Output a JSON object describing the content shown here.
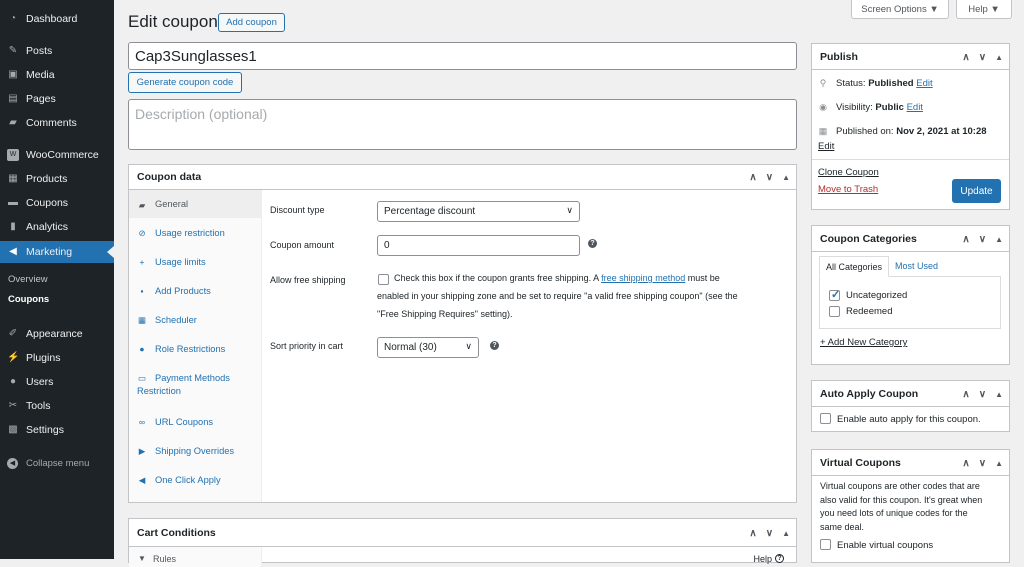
{
  "sidebar": {
    "items": [
      {
        "label": "Dashboard",
        "icon": "dashboard-icon"
      },
      {
        "label": "Posts",
        "icon": "pin-icon"
      },
      {
        "label": "Media",
        "icon": "media-icon"
      },
      {
        "label": "Pages",
        "icon": "pages-icon"
      },
      {
        "label": "Comments",
        "icon": "comments-icon"
      },
      {
        "label": "WooCommerce",
        "icon": "woocommerce-icon"
      },
      {
        "label": "Products",
        "icon": "products-icon"
      },
      {
        "label": "Coupons",
        "icon": "coupons-icon"
      },
      {
        "label": "Analytics",
        "icon": "analytics-icon"
      },
      {
        "label": "Marketing",
        "icon": "megaphone-icon"
      },
      {
        "label": "Appearance",
        "icon": "brush-icon"
      },
      {
        "label": "Plugins",
        "icon": "plugins-icon"
      },
      {
        "label": "Users",
        "icon": "users-icon"
      },
      {
        "label": "Tools",
        "icon": "tools-icon"
      },
      {
        "label": "Settings",
        "icon": "settings-icon"
      }
    ],
    "submenu": [
      "Overview",
      "Coupons"
    ],
    "collapse": "Collapse menu"
  },
  "top": {
    "screen_options": "Screen Options ▼",
    "help": "Help ▼"
  },
  "header": {
    "title": "Edit coupon",
    "add_button": "Add coupon"
  },
  "coupon": {
    "code": "Cap3Sunglasses1",
    "generate_button": "Generate coupon code",
    "description_placeholder": "Description (optional)"
  },
  "coupon_data": {
    "title": "Coupon data",
    "tabs": [
      {
        "label": "General",
        "icon": "general-icon"
      },
      {
        "label": "Usage restriction",
        "icon": "restriction-icon"
      },
      {
        "label": "Usage limits",
        "icon": "limits-icon"
      },
      {
        "label": "Add Products",
        "icon": "add-products-icon"
      },
      {
        "label": "Scheduler",
        "icon": "calendar-icon"
      },
      {
        "label": "Role Restrictions",
        "icon": "role-icon"
      },
      {
        "label": "Payment Methods Restriction",
        "icon": "payment-icon"
      },
      {
        "label": "URL Coupons",
        "icon": "link-icon"
      },
      {
        "label": "Shipping Overrides",
        "icon": "shipping-icon"
      },
      {
        "label": "One Click Apply",
        "icon": "click-icon"
      }
    ],
    "fields": {
      "discount_type_label": "Discount type",
      "discount_type_value": "Percentage discount",
      "coupon_amount_label": "Coupon amount",
      "coupon_amount_value": "0",
      "free_shipping_label": "Allow free shipping",
      "free_shipping_text_1": "Check this box if the coupon grants free shipping. A",
      "free_shipping_link": "free shipping method",
      "free_shipping_text_2": "must be",
      "free_shipping_text_3": "enabled in your shipping zone and be set to require \"a valid free shipping coupon\" (see the",
      "free_shipping_text_4": "\"Free Shipping Requires\" setting).",
      "sort_priority_label": "Sort priority in cart",
      "sort_priority_value": "Normal (30)"
    }
  },
  "cart_conditions": {
    "title": "Cart Conditions",
    "rules_label": "Rules",
    "help": "Help"
  },
  "publish": {
    "title": "Publish",
    "status_label": "Status:",
    "status_value": "Published",
    "visibility_label": "Visibility:",
    "visibility_value": "Public",
    "published_label": "Published on:",
    "published_value": "Nov 2, 2021 at 10:28",
    "edit": "Edit",
    "clone": "Clone Coupon",
    "trash": "Move to Trash",
    "update": "Update"
  },
  "categories": {
    "title": "Coupon Categories",
    "tab_all": "All Categories",
    "tab_used": "Most Used",
    "items": [
      {
        "label": "Uncategorized",
        "checked": true
      },
      {
        "label": "Redeemed",
        "checked": false
      }
    ],
    "add_new": "+ Add New Category"
  },
  "auto_apply": {
    "title": "Auto Apply Coupon",
    "label": "Enable auto apply for this coupon."
  },
  "virtual": {
    "title": "Virtual Coupons",
    "desc_lines": [
      "Virtual coupons are other codes that are",
      "also valid for this coupon. It's great when",
      "you need lots of unique codes for the",
      "same deal."
    ],
    "enable_label": "Enable virtual coupons"
  },
  "colors": {
    "accent": "#2271b1",
    "sidebar_bg": "#1d2327",
    "danger": "#b32d2e"
  }
}
